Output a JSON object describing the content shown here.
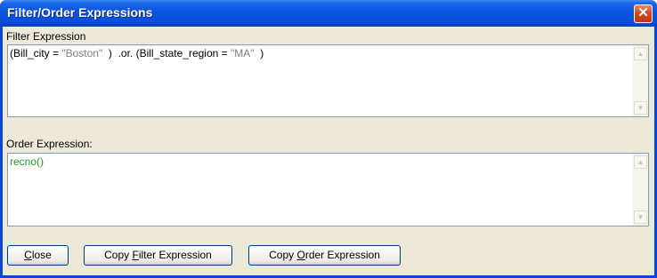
{
  "window": {
    "title": "Filter/Order Expressions",
    "close_glyph": "✕"
  },
  "filter": {
    "label": "Filter Expression",
    "parts": {
      "p1": "(Bill_city = ",
      "s1": "\"Boston\"",
      "p2": "  )  .or. (Bill_state_region = ",
      "s2": "\"MA\"",
      "p3": "  )"
    }
  },
  "order": {
    "label": "Order Expression:",
    "value": "recno()"
  },
  "scroll": {
    "up_glyph": "▲",
    "down_glyph": "▼"
  },
  "buttons": {
    "close": {
      "pre": "",
      "accel": "C",
      "post": "lose"
    },
    "copy_filter": {
      "pre": "Copy ",
      "accel": "F",
      "post": "ilter Expression"
    },
    "copy_order": {
      "pre": "Copy ",
      "accel": "O",
      "post": "rder Expression"
    }
  },
  "colors": {
    "title_bar": "#0a4fd8",
    "dialog_bg": "#ece9d8",
    "order_text": "#1ea01e",
    "string_literal": "#808080"
  }
}
